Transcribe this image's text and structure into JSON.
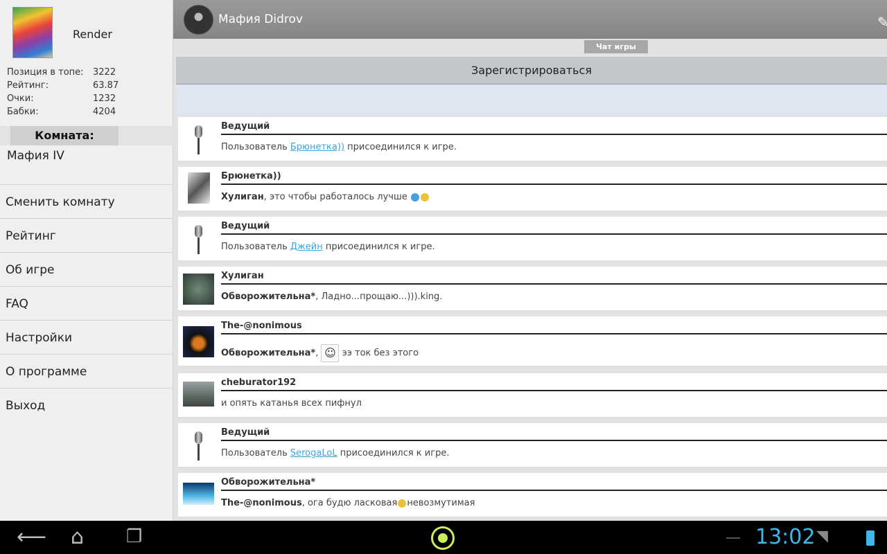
{
  "profile": {
    "name": "Render",
    "stats": [
      {
        "label": "Позиция в топе:",
        "value": "3222"
      },
      {
        "label": "Рейтинг:",
        "value": "63.87"
      },
      {
        "label": "Очки:",
        "value": "1232"
      },
      {
        "label": "Бабки:",
        "value": "4204"
      }
    ]
  },
  "room": {
    "header": "Комната:",
    "name": "Мафия IV"
  },
  "menu": [
    {
      "label": "Сменить комнату"
    },
    {
      "label": "Рейтинг"
    },
    {
      "label": "Об игре"
    },
    {
      "label": "FAQ"
    },
    {
      "label": "Настройки"
    },
    {
      "label": "О программе"
    },
    {
      "label": "Выход"
    }
  ],
  "header": {
    "title": "Мафия Didrov",
    "edit_icon": "pencil-icon"
  },
  "chat_tab": "Чат игры",
  "register_label": "Зарегистрироваться",
  "messages": [
    {
      "author": "Ведущий",
      "pre": "Пользователь ",
      "link": "Брюнетка))",
      "post": " присоединился к игре."
    },
    {
      "author": "Брюнетка))",
      "bold": "Хулиган",
      "post": ", это чтобы работалось лучше "
    },
    {
      "author": "Ведущий",
      "pre": "Пользователь ",
      "link": "Джейн",
      "post": " присоединился к игре."
    },
    {
      "author": "Хулиган",
      "bold": "Обворожительна*",
      "post": ", Ладно...прощаю...))).king."
    },
    {
      "author": "The-@nonimous",
      "bold": "Обворожительна*",
      "post": ", ",
      "post2": " ээ ток без этого"
    },
    {
      "author": "cheburator192",
      "post": "и опять катанья всех пифнул"
    },
    {
      "author": "Ведущий",
      "pre": "Пользователь ",
      "link": "SerogaLoL",
      "post": " присоединился к игре."
    },
    {
      "author": "Обворожительна*",
      "bold": "The-@nonimous",
      "post": ", ога будю ласковая",
      "post2": "невозмутимая"
    }
  ],
  "status": {
    "clock": "13:02"
  },
  "colors": {
    "accent": "#3fb8e8",
    "home": "#c9ef5c",
    "link": "#3aa4d8"
  }
}
